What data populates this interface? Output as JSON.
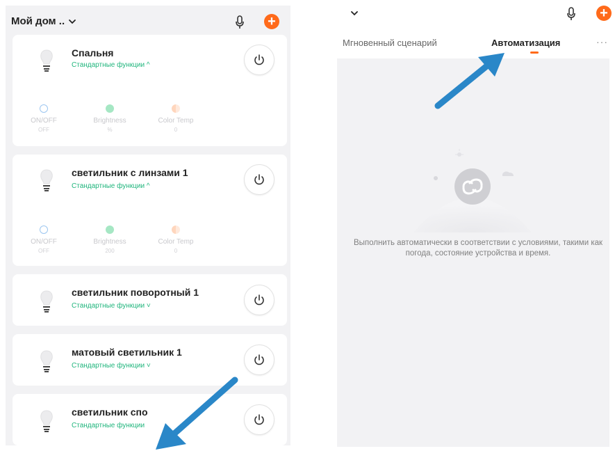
{
  "left_panel": {
    "home_title": "Мой дом ..",
    "colors": {
      "accent": "#ff6a1a",
      "green": "#1fb57c"
    },
    "devices": [
      {
        "name": "Спальня",
        "subtitle": "Стандартные функции ^",
        "expanded": true,
        "controls": [
          {
            "label": "ON/OFF",
            "value": "OFF",
            "icon": "power-icon"
          },
          {
            "label": "Brightness",
            "value": "%",
            "icon": "brightness-icon"
          },
          {
            "label": "Color Temp",
            "value": "0",
            "icon": "color-temp-icon"
          }
        ]
      },
      {
        "name": "светильник с линзами 1",
        "subtitle": "Стандартные функции ^",
        "expanded": true,
        "controls": [
          {
            "label": "ON/OFF",
            "value": "OFF",
            "icon": "power-icon"
          },
          {
            "label": "Brightness",
            "value": "200",
            "icon": "brightness-icon"
          },
          {
            "label": "Color Temp",
            "value": "0",
            "icon": "color-temp-icon"
          }
        ]
      },
      {
        "name": "светильник поворотный 1",
        "subtitle": "Стандартные функции ˅",
        "expanded": false
      },
      {
        "name": "матовый светильник 1",
        "subtitle": "Стандартные функции ˅",
        "expanded": false
      },
      {
        "name": "светильник спо",
        "subtitle": "Стандартные функции",
        "expanded": false
      }
    ]
  },
  "right_panel": {
    "tabs": [
      {
        "label": "Мгновенный сценарий",
        "active": false
      },
      {
        "label": "Автоматизация",
        "active": true
      }
    ],
    "more_label": "···",
    "empty_state_text": "Выполнить автоматически в соответствии с условиями, такими как погода, состояние устройства и время."
  },
  "annotation_color": "#2a87c8"
}
